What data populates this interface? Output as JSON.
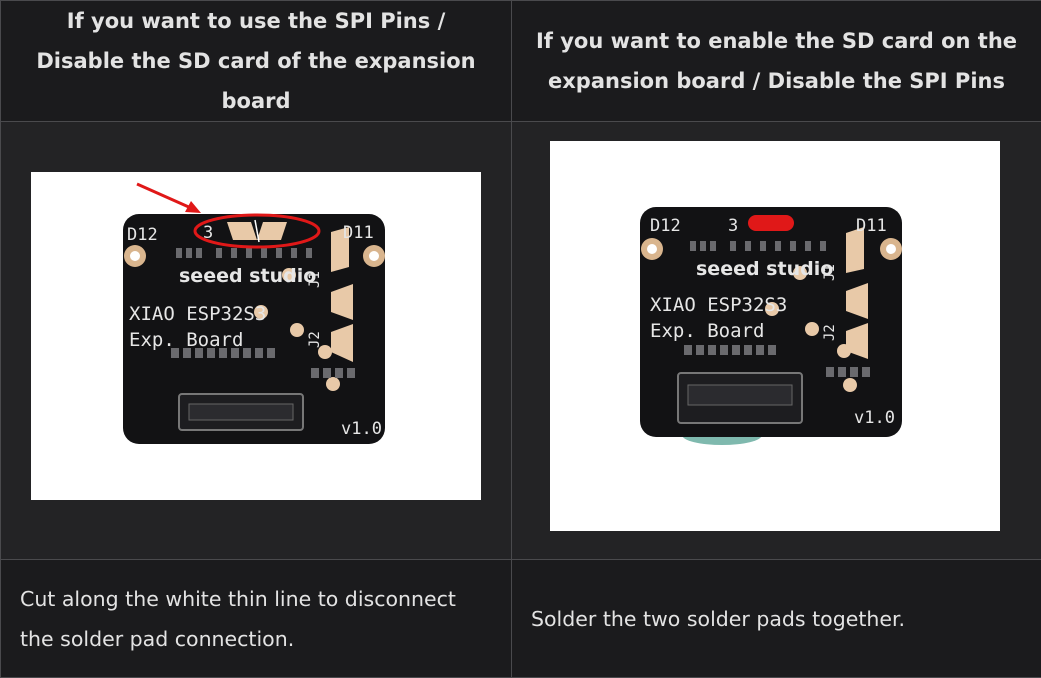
{
  "table": {
    "headers": [
      {
        "text": "If you want to use the SPI Pins / Disable the SD card of the expansion board"
      },
      {
        "text": "If you want to enable the SD card on the expansion board / Disable the SPI Pins"
      }
    ],
    "descriptions": [
      {
        "text": "Cut along the white thin line to disconnect the solder pad connection."
      },
      {
        "text": "Solder the two solder pads together."
      }
    ]
  },
  "board": {
    "brand": "seeed studio",
    "model_line1": "XIAO ESP32S3",
    "model_line2": "Exp. Board",
    "pin_left": "D12",
    "pin_middle": "3",
    "pin_right": "D11",
    "jumper1": "J1",
    "jumper2": "J2",
    "version": "v1.0"
  },
  "colors": {
    "background": "#1b1b1d",
    "border": "#4a4a4d",
    "text": "#e3e3e3",
    "pcb": "#121214",
    "pad": "#e8c9a8",
    "annotation": "#e01818"
  }
}
